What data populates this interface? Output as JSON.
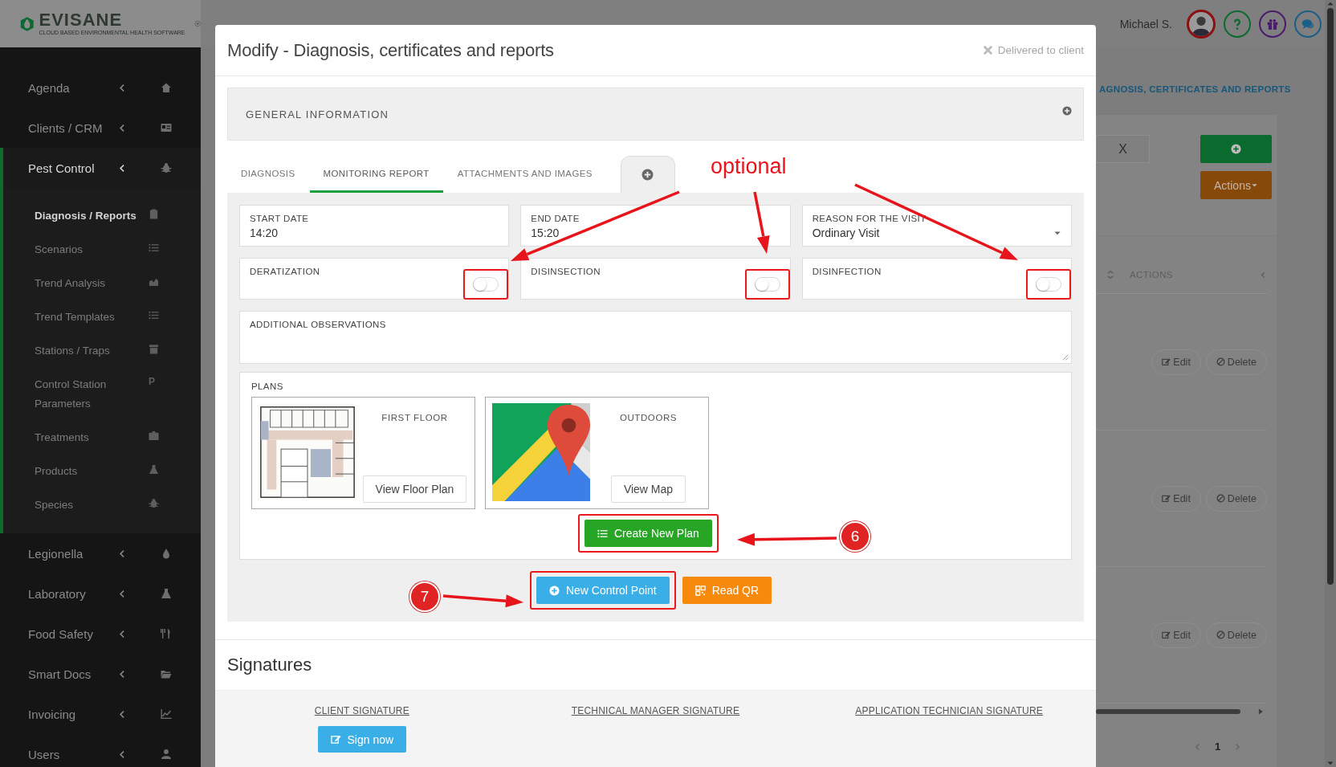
{
  "header": {
    "logo": "EVISANE",
    "tagline": "CLOUD BASED ENVIRONMENTAL HEALTH SOFTWARE",
    "user_name": "Michael S."
  },
  "sidebar": {
    "items": [
      {
        "label": "Agenda",
        "expanded": false
      },
      {
        "label": "Clients / CRM",
        "expanded": false
      },
      {
        "label": "Pest Control",
        "expanded": true,
        "children": [
          {
            "label": "Diagnosis / Reports",
            "selected": true
          },
          {
            "label": "Scenarios",
            "selected": false
          },
          {
            "label": "Trend Analysis",
            "selected": false
          },
          {
            "label": "Trend Templates",
            "selected": false
          },
          {
            "label": "Stations / Traps",
            "selected": false
          },
          {
            "label": "Control Station Parameters",
            "selected": false,
            "icon_text": "P"
          },
          {
            "label": "Treatments",
            "selected": false
          },
          {
            "label": "Products",
            "selected": false
          },
          {
            "label": "Species",
            "selected": false
          }
        ]
      },
      {
        "label": "Legionella",
        "expanded": false
      },
      {
        "label": "Laboratory",
        "expanded": false
      },
      {
        "label": "Food Safety",
        "expanded": false
      },
      {
        "label": "Smart Docs",
        "expanded": false
      },
      {
        "label": "Invoicing",
        "expanded": false
      },
      {
        "label": "Users",
        "expanded": false
      }
    ]
  },
  "page": {
    "breadcrumb": "AGNOSIS, CERTIFICATES AND REPORTS",
    "clear_button": "X",
    "actions_button": "Actions",
    "table": {
      "columns": [
        "ACTIONS"
      ],
      "rows": [
        {
          "buttons": [
            "Edit",
            "Delete"
          ]
        },
        {
          "buttons": [
            "Edit",
            "Delete"
          ]
        },
        {
          "buttons": [
            "Edit",
            "Delete"
          ]
        }
      ]
    },
    "pagination": [
      {
        "label": "1",
        "selected": true
      }
    ]
  },
  "modal": {
    "title": "Modify - Diagnosis, certificates and reports",
    "status": "Delivered to client",
    "general_information": "GENERAL INFORMATION",
    "tabs": [
      {
        "label": "DIAGNOSIS",
        "selected": false
      },
      {
        "label": "MONITORING REPORT",
        "selected": true
      },
      {
        "label": "ATTACHMENTS AND IMAGES",
        "selected": false
      }
    ],
    "fields": [
      {
        "kind": "text",
        "label": "START DATE",
        "value": "14:20"
      },
      {
        "kind": "text",
        "label": "END DATE",
        "value": "15:20"
      },
      {
        "kind": "select",
        "label": "REASON FOR THE VISIT",
        "value": "Ordinary Visit"
      }
    ],
    "switches": [
      {
        "label": "DERATIZATION",
        "on": false,
        "highlighted": true
      },
      {
        "label": "DISINSECTION",
        "on": false,
        "highlighted": true
      },
      {
        "label": "DISINFECTION",
        "on": false,
        "highlighted": true
      }
    ],
    "observations": {
      "label": "ADDITIONAL OBSERVATIONS"
    },
    "plans": {
      "title": "PLANS",
      "items": [
        {
          "kind": "floor_plan",
          "name": "FIRST FLOOR",
          "button": "View Floor Plan"
        },
        {
          "kind": "map",
          "name": "OUTDOORS",
          "button": "View Map"
        }
      ],
      "create_button": {
        "label": "Create New Plan",
        "highlighted": true
      }
    },
    "actions": [
      {
        "kind": "primary",
        "label": "New Control Point",
        "highlighted": true
      },
      {
        "kind": "warning",
        "label": "Read QR",
        "highlighted": false
      }
    ],
    "signatures": {
      "title": "Signatures",
      "items": [
        {
          "label": "CLIENT SIGNATURE",
          "button": "Sign now"
        },
        {
          "label": "TECHNICAL MANAGER SIGNATURE"
        },
        {
          "label": "APPLICATION TECHNICIAN SIGNATURE"
        }
      ]
    }
  },
  "annotations": {
    "note": "optional",
    "steps": [
      "6",
      "7"
    ]
  }
}
